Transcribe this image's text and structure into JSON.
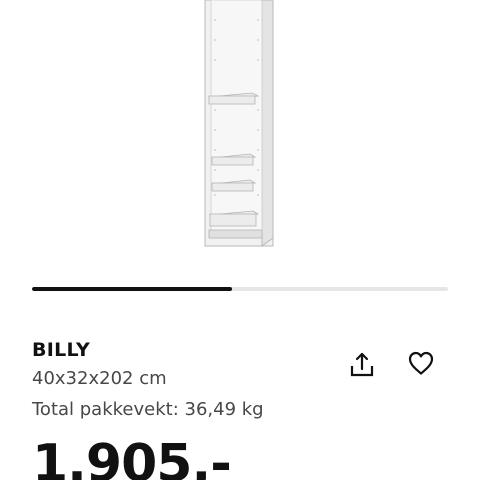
{
  "gallery": {
    "progress": 0.48
  },
  "product": {
    "name": "BILLY",
    "dimensions": "40x32x202 cm",
    "package_weight": "Total pakkevekt: 36,49 kg",
    "price": "1.905,-"
  },
  "icons": {
    "share": "share-icon",
    "favourite": "heart-icon"
  },
  "colors": {
    "text": "#111111",
    "secondary_text": "#484848",
    "track": "#e6e6e6"
  }
}
